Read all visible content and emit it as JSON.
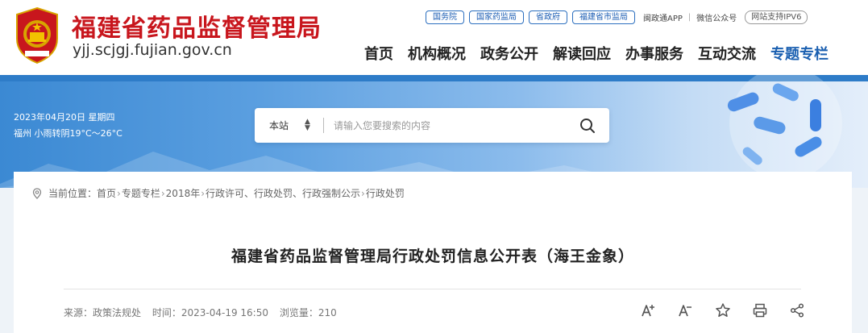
{
  "header": {
    "site_title": "福建省药品监督管理局",
    "site_domain": "yjj.scjgj.fujian.gov.cn",
    "gov_links": [
      "国务院",
      "国家药监局",
      "省政府",
      "福建省市监局"
    ],
    "plain_links": [
      "闽政通APP",
      "微信公众号"
    ],
    "ipv6_badge": "网站支持IPV6",
    "nav": [
      "首页",
      "机构概况",
      "政务公开",
      "解读回应",
      "办事服务",
      "互动交流",
      "专题专栏"
    ]
  },
  "banner": {
    "date": "2023年04月20日 星期四",
    "weather": "福州 小雨转阴19°C～26°C",
    "search": {
      "scope": "本站",
      "placeholder": "请输入您要搜索的内容"
    }
  },
  "breadcrumb": {
    "prefix": "当前位置：",
    "items": [
      "首页",
      "专题专栏",
      "2018年",
      "行政许可、行政处罚、行政强制公示",
      "行政处罚"
    ]
  },
  "article": {
    "title": "福建省药品监督管理局行政处罚信息公开表（海王金象）",
    "source": "来源：政策法规处",
    "time": "时间：2023-04-19 16:50",
    "views": "浏览量：210"
  },
  "icons": {
    "emblem": "national-emblem-icon",
    "search": "search-icon",
    "location": "location-pin-icon",
    "font_up": "font-increase-icon",
    "font_down": "font-decrease-icon",
    "star": "star-icon",
    "print": "print-icon",
    "share": "share-icon"
  },
  "colors": {
    "brand_red": "#c8161d",
    "accent_blue": "#1a5fb0",
    "banner_blue": "#3b89d3"
  }
}
